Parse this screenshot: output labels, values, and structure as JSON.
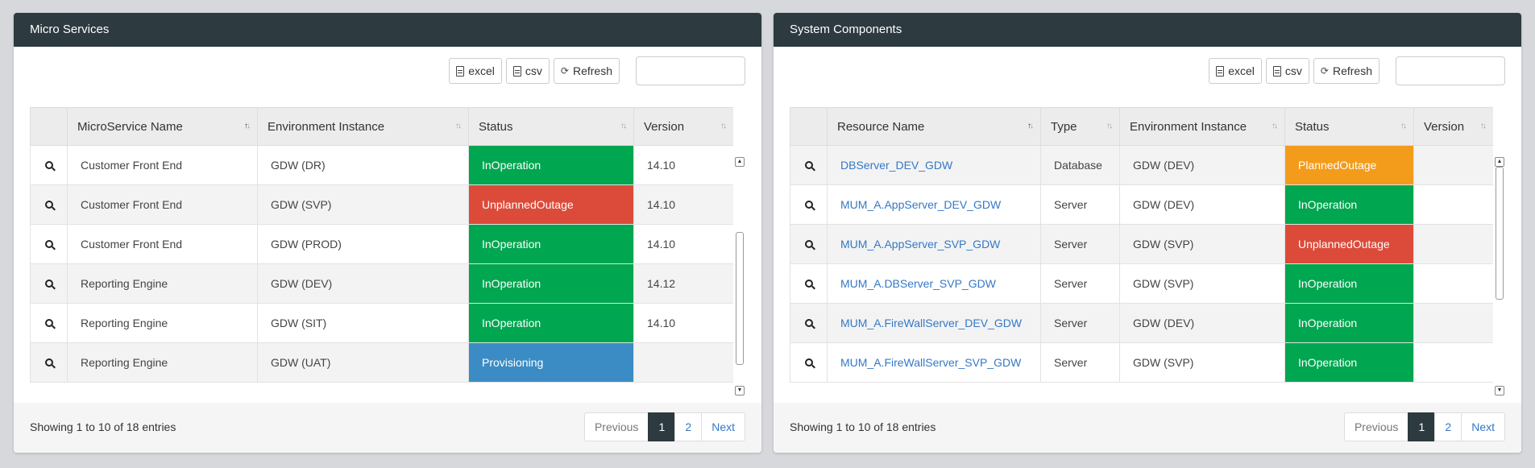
{
  "left": {
    "title": "Micro Services",
    "buttons": {
      "excel": "excel",
      "csv": "csv",
      "refresh": "Refresh"
    },
    "columns": [
      "MicroService Name",
      "Environment Instance",
      "Status",
      "Version"
    ],
    "rows": [
      {
        "name": "Customer Front End",
        "env": "GDW (DR)",
        "status": "InOperation",
        "version": "14.10"
      },
      {
        "name": "Customer Front End",
        "env": "GDW (SVP)",
        "status": "UnplannedOutage",
        "version": "14.10"
      },
      {
        "name": "Customer Front End",
        "env": "GDW (PROD)",
        "status": "InOperation",
        "version": "14.10"
      },
      {
        "name": "Reporting Engine",
        "env": "GDW (DEV)",
        "status": "InOperation",
        "version": "14.12"
      },
      {
        "name": "Reporting Engine",
        "env": "GDW (SIT)",
        "status": "InOperation",
        "version": "14.10"
      },
      {
        "name": "Reporting Engine",
        "env": "GDW (UAT)",
        "status": "Provisioning",
        "version": ""
      }
    ],
    "info": "Showing 1 to 10 of 18 entries",
    "pager": {
      "previous": "Previous",
      "page1": "1",
      "page2": "2",
      "next": "Next"
    }
  },
  "right": {
    "title": "System Components",
    "buttons": {
      "excel": "excel",
      "csv": "csv",
      "refresh": "Refresh"
    },
    "columns": [
      "Resource Name",
      "Type",
      "Environment Instance",
      "Status",
      "Version"
    ],
    "rows": [
      {
        "name": "DBServer_DEV_GDW",
        "type": "Database",
        "env": "GDW (DEV)",
        "status": "PlannedOutage",
        "version": ""
      },
      {
        "name": "MUM_A.AppServer_DEV_GDW",
        "type": "Server",
        "env": "GDW (DEV)",
        "status": "InOperation",
        "version": ""
      },
      {
        "name": "MUM_A.AppServer_SVP_GDW",
        "type": "Server",
        "env": "GDW (SVP)",
        "status": "UnplannedOutage",
        "version": ""
      },
      {
        "name": "MUM_A.DBServer_SVP_GDW",
        "type": "Server",
        "env": "GDW (SVP)",
        "status": "InOperation",
        "version": ""
      },
      {
        "name": "MUM_A.FireWallServer_DEV_GDW",
        "type": "Server",
        "env": "GDW (DEV)",
        "status": "InOperation",
        "version": ""
      },
      {
        "name": "MUM_A.FireWallServer_SVP_GDW",
        "type": "Server",
        "env": "GDW (SVP)",
        "status": "InOperation",
        "version": ""
      }
    ],
    "info": "Showing 1 to 10 of 18 entries",
    "pager": {
      "previous": "Previous",
      "page1": "1",
      "page2": "2",
      "next": "Next"
    }
  }
}
